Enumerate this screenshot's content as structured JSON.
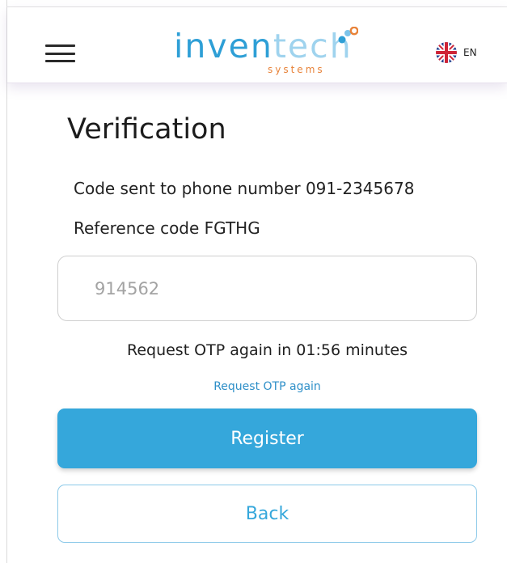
{
  "header": {
    "logo": {
      "text_part1": "inven",
      "text_part2": "tech",
      "subtext": "systems"
    },
    "language": {
      "code": "EN",
      "flag_icon": "uk-flag-icon"
    },
    "menu_icon": "hamburger-menu-icon"
  },
  "page": {
    "title": "Verification",
    "info_sent": "Code sent to phone number 091-2345678",
    "info_ref": "Reference code FGTHG",
    "otp_placeholder": "914562",
    "countdown": "Request OTP again in 01:56 minutes",
    "resend_link": "Request OTP again",
    "register_button": "Register",
    "back_button": "Back"
  },
  "colors": {
    "accent": "#35a7db",
    "link": "#2e8fc8",
    "logo_dark": "#2e9fd6",
    "logo_light": "#9fd3ee",
    "logo_orange": "#e8833a"
  }
}
